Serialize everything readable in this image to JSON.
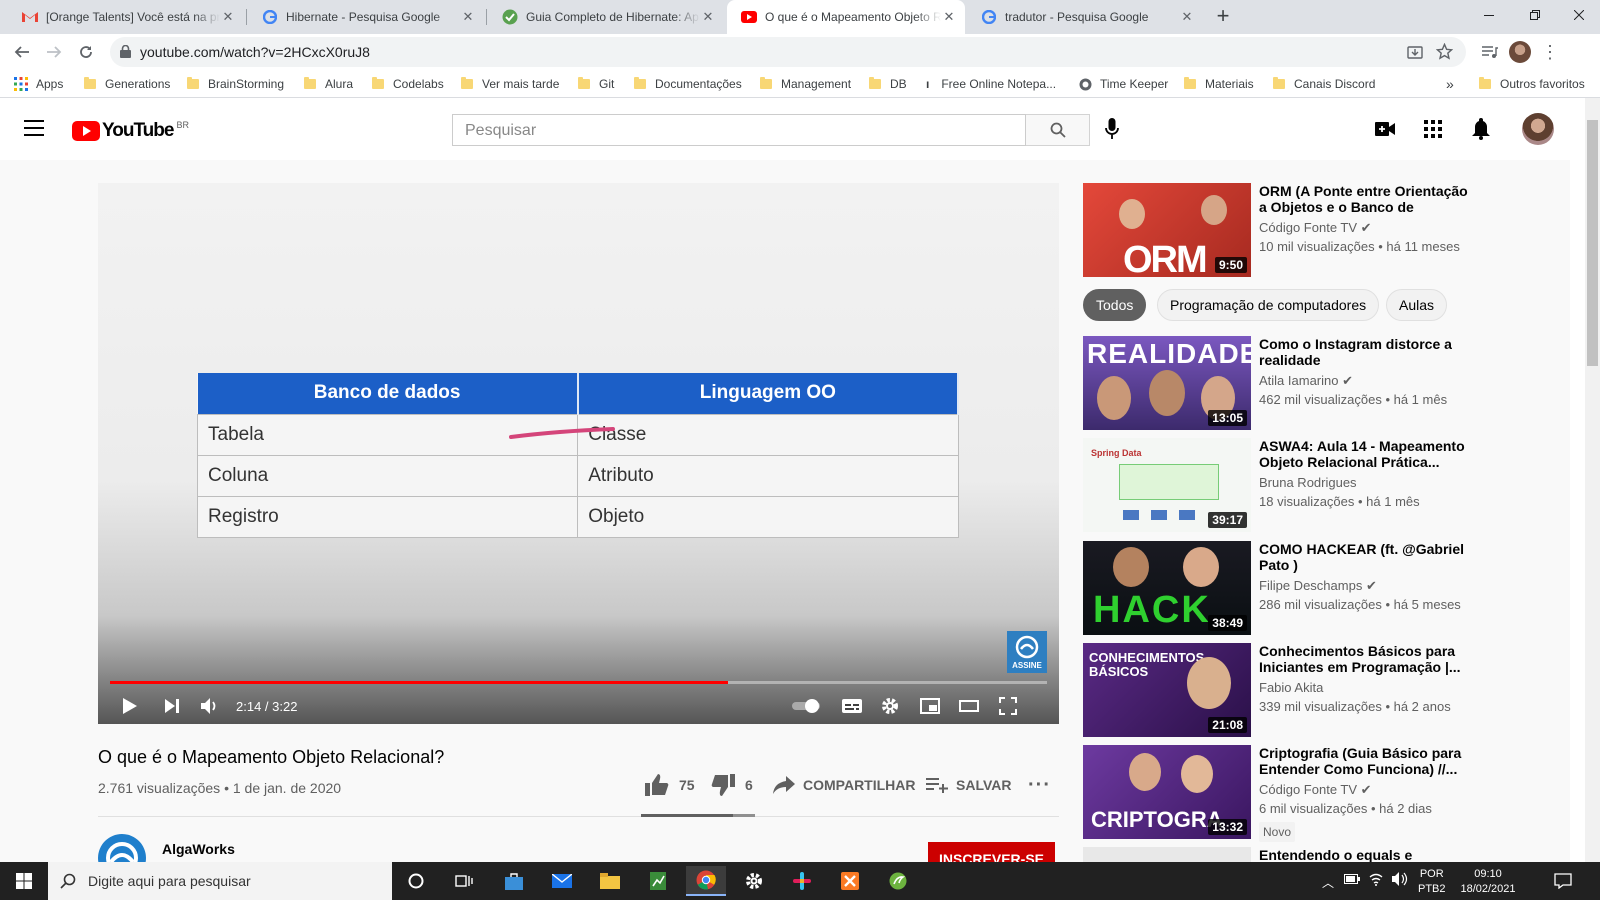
{
  "browser": {
    "tabs": [
      {
        "title": "[Orange Talents] Você está na pró",
        "icon": "gmail-icon"
      },
      {
        "title": "Hibernate - Pesquisa Google",
        "icon": "google-icon"
      },
      {
        "title": "Guia Completo de Hibernate: Ap",
        "icon": "site-icon"
      },
      {
        "title": "O que é o Mapeamento Objeto R",
        "icon": "youtube-icon",
        "active": true
      },
      {
        "title": "tradutor - Pesquisa Google",
        "icon": "google-icon"
      }
    ],
    "new_tab": "+",
    "url": "youtube.com/watch?v=2HCxcX0ruJ8",
    "bookmarks": [
      {
        "label": "Apps",
        "icon": "apps-grid-icon"
      },
      {
        "label": "Generations",
        "icon": "folder-icon"
      },
      {
        "label": "BrainStorming",
        "icon": "folder-icon"
      },
      {
        "label": "Alura",
        "icon": "folder-icon"
      },
      {
        "label": "Codelabs",
        "icon": "folder-icon"
      },
      {
        "label": "Ver mais tarde",
        "icon": "folder-icon"
      },
      {
        "label": "Git",
        "icon": "folder-icon"
      },
      {
        "label": "Documentações",
        "icon": "folder-icon"
      },
      {
        "label": "Management",
        "icon": "folder-icon"
      },
      {
        "label": "DB",
        "icon": "folder-icon"
      },
      {
        "label": "Free Online Notepa...",
        "icon": "notepad-icon"
      },
      {
        "label": "Time Keeper",
        "icon": "globe-icon"
      },
      {
        "label": "Materiais",
        "icon": "folder-icon"
      },
      {
        "label": "Canais Discord",
        "icon": "folder-icon"
      }
    ],
    "bookmarks_more": "»",
    "other_bookmarks": "Outros favoritos"
  },
  "youtube": {
    "logo_text": "YouTube",
    "logo_region": "BR",
    "search_placeholder": "Pesquisar"
  },
  "player": {
    "slide_headers": [
      "Banco de dados",
      "Linguagem OO"
    ],
    "slide_rows": [
      [
        "Tabela",
        "Classe"
      ],
      [
        "Coluna",
        "Atributo"
      ],
      [
        "Registro",
        "Objeto"
      ]
    ],
    "watermark": "ASSINE",
    "time": "2:14 / 3:22",
    "progress": 0.66
  },
  "video": {
    "title": "O que é o Mapeamento Objeto Relacional?",
    "meta": "2.761 visualizações • 1 de jan. de 2020",
    "likes": "75",
    "dislikes": "6",
    "share": "COMPARTILHAR",
    "save": "SALVAR",
    "channel": "AlgaWorks",
    "subscribe": "INSCREVER-SE"
  },
  "sidebar": {
    "chips": [
      "Todos",
      "Programação de computadores",
      "Aulas"
    ],
    "items": [
      {
        "title": "ORM (A Ponte entre Orientação a Objetos e o Banco de Dados)...",
        "channel": "Código Fonte TV",
        "verified": true,
        "stats": "10 mil visualizações • há 11 meses",
        "duration": "9:50",
        "thumb_text": "ORM",
        "thumb_color": "#c8382b"
      },
      {
        "title": "Como o Instagram distorce a realidade",
        "channel": "Atila Iamarino",
        "verified": true,
        "stats": "462 mil visualizações • há 1 mês",
        "duration": "13:05",
        "thumb_text": "REALIDADE",
        "thumb_color": "#6a4aa8"
      },
      {
        "title": "ASWA4: Aula 14 - Mapeamento Objeto Relacional Prática...",
        "channel": "Bruna Rodrigues",
        "verified": false,
        "stats": "18 visualizações • há 1 mês",
        "duration": "39:17",
        "thumb_text": "Spring Data",
        "thumb_color": "#f4f7f4"
      },
      {
        "title": "COMO HACKEAR (ft. @Gabriel Pato )",
        "channel": "Filipe Deschamps",
        "verified": true,
        "stats": "286 mil visualizações • há 5 meses",
        "duration": "38:49",
        "thumb_text": "HACK",
        "thumb_color": "#101820"
      },
      {
        "title": "Conhecimentos Básicos para Iniciantes em Programação |...",
        "channel": "Fabio Akita",
        "verified": false,
        "stats": "339 mil visualizações • há 2 anos",
        "duration": "21:08",
        "thumb_text": "CONHECIMENTOS BÁSICOS",
        "thumb_color": "#4a1f6e"
      },
      {
        "title": "Criptografia (Guia Básico para Entender Como Funciona) //...",
        "channel": "Código Fonte TV",
        "verified": true,
        "stats": "6 mil visualizações • há 2 dias",
        "duration": "13:32",
        "thumb_text": "CRIPTOGRA",
        "thumb_color": "#5d2a8a",
        "badge": "Novo"
      },
      {
        "title": "Entendendo o equals e",
        "channel": "",
        "verified": false,
        "stats": "",
        "duration": "",
        "thumb_text": "",
        "thumb_color": "#e8e8e8"
      }
    ]
  },
  "taskbar": {
    "search_placeholder": "Digite aqui para pesquisar",
    "lang": "POR",
    "lang2": "PTB2",
    "time": "09:10",
    "date": "18/02/2021"
  }
}
